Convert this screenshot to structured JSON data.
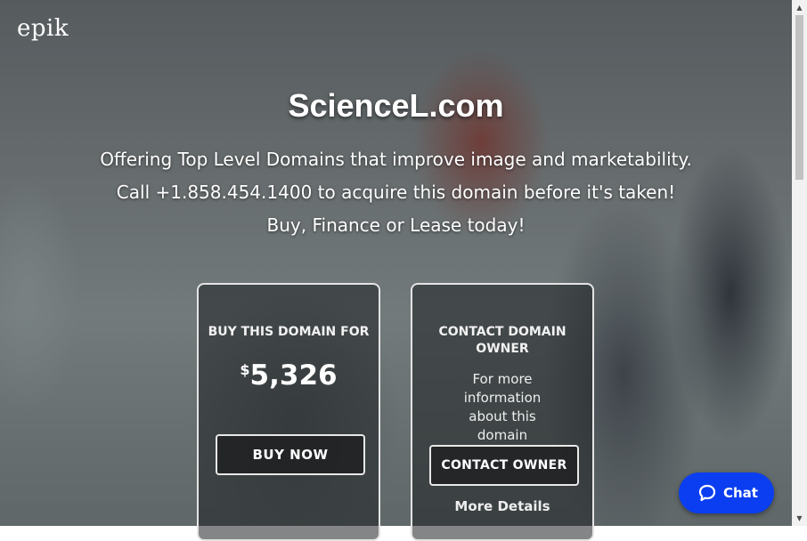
{
  "logo": {
    "text": "epik"
  },
  "hero": {
    "title": "ScienceL.com",
    "lines": [
      "Offering Top Level Domains that improve image and marketability.",
      "Call +1.858.454.1400 to acquire this domain before it's taken!",
      "Buy, Finance or Lease today!"
    ]
  },
  "buy_card": {
    "heading": "BUY THIS DOMAIN FOR",
    "currency": "$",
    "price": "5,326",
    "button": "BUY NOW"
  },
  "contact_card": {
    "heading": "CONTACT DOMAIN OWNER",
    "info": "For more information about this domain",
    "button": "CONTACT OWNER",
    "details": "More Details"
  },
  "chat": {
    "label": "Chat",
    "icon": "chat-bubble-icon",
    "color": "#0a3ef0"
  }
}
